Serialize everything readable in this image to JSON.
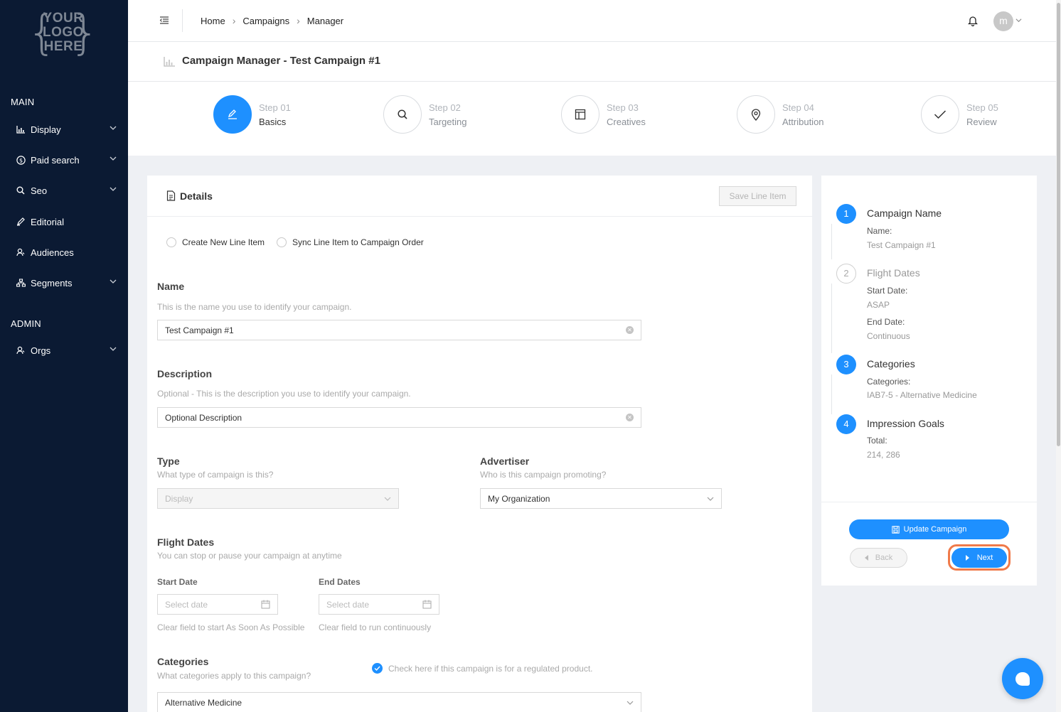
{
  "sidebar": {
    "logo": {
      "line1": "YOUR",
      "line2": "LOGO",
      "line3": "HERE"
    },
    "main_label": "MAIN",
    "admin_label": "ADMIN",
    "items": [
      {
        "label": "Display",
        "icon": "chart-icon"
      },
      {
        "label": "Paid search",
        "icon": "dollar-icon"
      },
      {
        "label": "Seo",
        "icon": "search-icon"
      },
      {
        "label": "Editorial",
        "icon": "pen-icon"
      },
      {
        "label": "Audiences",
        "icon": "audience-icon"
      },
      {
        "label": "Segments",
        "icon": "segments-icon"
      }
    ],
    "admin_items": [
      {
        "label": "Orgs",
        "icon": "orgs-icon"
      }
    ]
  },
  "topbar": {
    "breadcrumb": [
      "Home",
      "Campaigns",
      "Manager"
    ],
    "avatar_initial": "m"
  },
  "page": {
    "title": "Campaign Manager - Test Campaign #1"
  },
  "steps": [
    {
      "num": "Step 01",
      "name": "Basics",
      "icon": "edit-icon"
    },
    {
      "num": "Step 02",
      "name": "Targeting",
      "icon": "search-icon"
    },
    {
      "num": "Step 03",
      "name": "Creatives",
      "icon": "layout-icon"
    },
    {
      "num": "Step 04",
      "name": "Attribution",
      "icon": "location-pin-icon"
    },
    {
      "num": "Step 05",
      "name": "Review",
      "icon": "checkmark-icon"
    }
  ],
  "details": {
    "title": "Details",
    "save_line_item": "Save Line Item",
    "radio_create": "Create New Line Item",
    "radio_sync": "Sync Line Item to Campaign Order",
    "name": {
      "label": "Name",
      "help": "This is the name you use to identify your campaign.",
      "value": "Test Campaign #1"
    },
    "description": {
      "label": "Description",
      "help": "Optional - This is the description you use to identify your campaign.",
      "value": "Optional Description"
    },
    "type": {
      "label": "Type",
      "help": "What type of campaign is this?",
      "value": "Display"
    },
    "advertiser": {
      "label": "Advertiser",
      "help": "Who is this campaign promoting?",
      "value": "My Organization"
    },
    "flight": {
      "label": "Flight Dates",
      "help": "You can stop or pause your campaign at anytime",
      "start_label": "Start Date",
      "end_label": "End Dates",
      "start_placeholder": "Select date",
      "end_placeholder": "Select date",
      "start_hint": "Clear field to start As Soon As Possible",
      "end_hint": "Clear field to run continuously"
    },
    "categories": {
      "label": "Categories",
      "help": "What categories apply to this campaign?",
      "regulated_check": "Check here if this campaign is for a regulated product.",
      "value": "Alternative Medicine"
    }
  },
  "summary": {
    "items": [
      {
        "num": "1",
        "title": "Campaign Name",
        "k1": "Name:",
        "v1": "Test Campaign #1"
      },
      {
        "num": "2",
        "title": "Flight Dates",
        "k1": "Start Date:",
        "v1": "ASAP",
        "k2": "End Date:",
        "v2": "Continuous"
      },
      {
        "num": "3",
        "title": "Categories",
        "k1": "Categories:",
        "v1": "IAB7-5 - Alternative Medicine"
      },
      {
        "num": "4",
        "title": "Impression Goals",
        "k1": "Total:",
        "v1": "214, 286"
      }
    ],
    "update_label": "Update Campaign",
    "back_label": "Back",
    "next_label": "Next"
  },
  "colors": {
    "primary": "#1e90ff",
    "sidebar_bg": "#0b1a33",
    "highlight": "#f07a4a"
  }
}
